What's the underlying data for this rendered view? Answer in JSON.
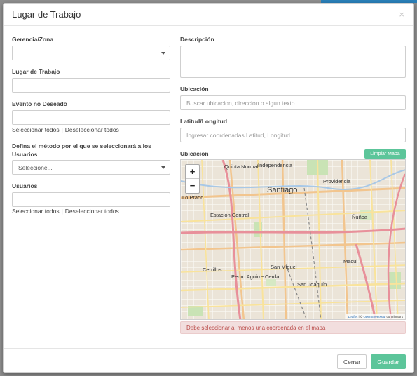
{
  "modal": {
    "title": "Lugar de Trabajo",
    "close_label": "×"
  },
  "left": {
    "gerencia_label": "Gerencia/Zona",
    "gerencia_value": "",
    "lugar_label": "Lugar de Trabajo",
    "lugar_value": "",
    "evento_label": "Evento no Deseado",
    "evento_value": "",
    "evento_select_all": "Seleccionar todos",
    "evento_separator": "|",
    "evento_deselect_all": "Deseleccionar todos",
    "metodo_label": "Defina el método por el que se seleccionará a los Usuarios",
    "metodo_value": "Seleccione...",
    "usuarios_label": "Usuarios",
    "usuarios_value": "",
    "usuarios_select_all": "Seleccionar todos",
    "usuarios_separator": "|",
    "usuarios_deselect_all": "Deseleccionar todos"
  },
  "right": {
    "descripcion_label": "Descripción",
    "ubicacion_label": "Ubicación",
    "ubicacion_placeholder": "Buscar ubicacion, direccion o algun texto",
    "latlon_label": "Latitud/Longitud",
    "latlon_placeholder": "Ingresar coordenadas Latitud, Longitud",
    "map_label": "Ubicación",
    "clear_map_label": "Limpiar Mapa",
    "alert_text": "Debe seleccionar al menos una coordenada en el mapa"
  },
  "map": {
    "zoom_in": "+",
    "zoom_out": "−",
    "attribution_leaflet": "Leaflet",
    "attribution_sep": " | © ",
    "attribution_osm": "OpenStreetMap",
    "attribution_tail": " contributors",
    "places": {
      "quinta_normal": "Quinta Normal",
      "independencia": "Independencia",
      "santiago": "Santiago",
      "providencia": "Providencia",
      "lo_prado": "Lo Prado",
      "estacion_central": "Estación Central",
      "nunoa": "Ñuñoa",
      "macul": "Macul",
      "cerrillos": "Cerrillos",
      "san_miguel": "San Miguel",
      "pedro_aguirre_cerda": "Pedro Aguirre Cerda",
      "san_joaquin": "San Joaquín"
    }
  },
  "footer": {
    "close_button": "Cerrar",
    "save_button": "Guardar"
  }
}
